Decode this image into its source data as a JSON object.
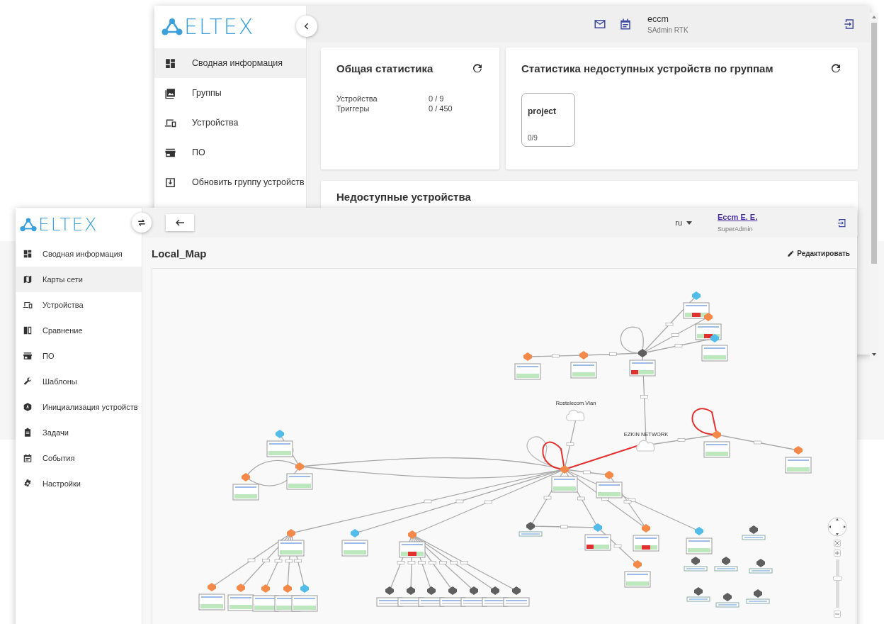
{
  "back_window": {
    "logo": "ELTEX",
    "sidebar": {
      "items": [
        {
          "label": "Сводная информация",
          "kind": "dashboard",
          "selected": true
        },
        {
          "label": "Группы",
          "kind": "image",
          "selected": false
        },
        {
          "label": "Устройства",
          "kind": "devices",
          "selected": false
        },
        {
          "label": "ПО",
          "kind": "store",
          "selected": false
        },
        {
          "label": "Обновить группу устройств",
          "kind": "download",
          "selected": false
        }
      ]
    },
    "header": {
      "user": "eccm",
      "role": "SAdmin RTK"
    },
    "general_stats": {
      "title": "Общая статистика",
      "rows": [
        {
          "label": "Устройства",
          "value": "0 / 9"
        },
        {
          "label": "Триггеры",
          "value": "0 / 450"
        }
      ]
    },
    "group_stats": {
      "title": "Статистика недоступных устройств по группам",
      "groups": [
        {
          "name": "project",
          "count": "0/9"
        }
      ]
    },
    "unavailable": {
      "title": "Недоступные устройства"
    }
  },
  "front_window": {
    "logo": "ELTEX",
    "sidebar": {
      "items": [
        {
          "label": "Сводная информация",
          "kind": "dashboard",
          "selected": false
        },
        {
          "label": "Карты сети",
          "kind": "map",
          "selected": true
        },
        {
          "label": "Устройства",
          "kind": "devices",
          "selected": false
        },
        {
          "label": "Сравнение",
          "kind": "compare",
          "selected": false
        },
        {
          "label": "ПО",
          "kind": "store",
          "selected": false
        },
        {
          "label": "Шаблоны",
          "kind": "wrench",
          "selected": false
        },
        {
          "label": "Инициализация устройств",
          "kind": "init",
          "selected": false
        },
        {
          "label": "Задачи",
          "kind": "clipboard",
          "selected": false
        },
        {
          "label": "События",
          "kind": "calendar",
          "selected": false
        },
        {
          "label": "Настройки",
          "kind": "gear",
          "selected": false
        }
      ]
    },
    "header": {
      "language": "ru",
      "user": "Eccm E. E.",
      "role": "SuperAdmin"
    },
    "map": {
      "title": "Local_Map",
      "edit_label": "Редактировать",
      "clouds": [
        {
          "label": "Rostelecom Vlan"
        },
        {
          "label": "EZKIN NETWORK"
        }
      ],
      "zoom": {
        "level": 0.64
      }
    }
  }
}
